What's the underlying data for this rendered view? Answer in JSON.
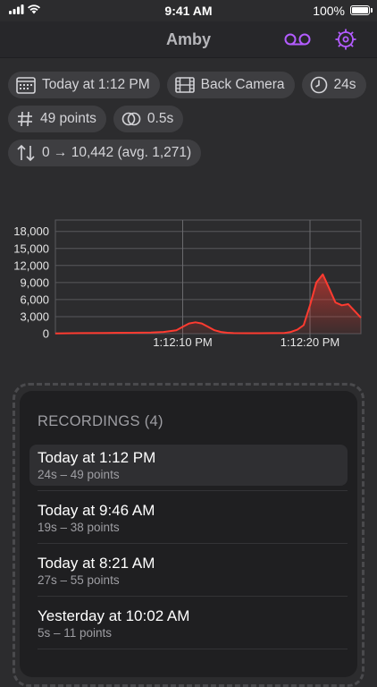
{
  "status_bar": {
    "time": "9:41 AM",
    "battery": "100%"
  },
  "nav": {
    "title": "Amby",
    "voicemail_icon": "voicemail-icon",
    "settings_icon": "gear-icon",
    "accent": "#b35cff"
  },
  "chips": {
    "date": "Today at 1:12 PM",
    "camera": "Back Camera",
    "duration": "24s",
    "points": "49 points",
    "interval": "0.5s",
    "range": "0 → 10,442 (avg. 1,271)"
  },
  "chart_data": {
    "type": "area",
    "x_tick_labels": [
      "1:12:10 PM",
      "1:12:20 PM"
    ],
    "x_range_seconds": [
      0,
      24
    ],
    "x_tick_positions_seconds": [
      10,
      20
    ],
    "y_ticks": [
      0,
      3000,
      6000,
      9000,
      12000,
      15000,
      18000
    ],
    "y_tick_labels": [
      "0",
      "3,000",
      "6,000",
      "9,000",
      "12,000",
      "15,000",
      "18,000"
    ],
    "ylim": [
      0,
      20000
    ],
    "grid": true,
    "color": "#ff3b30",
    "x": [
      0,
      2,
      4,
      6,
      7.5,
      8.5,
      9.5,
      10,
      10.5,
      11,
      11.5,
      12,
      12.5,
      13,
      13.5,
      14,
      15,
      16,
      17,
      18,
      18.5,
      19,
      19.5,
      20,
      20.5,
      21,
      21.5,
      22,
      22.5,
      23,
      23.5,
      24
    ],
    "y": [
      50,
      100,
      120,
      150,
      200,
      300,
      600,
      1200,
      1800,
      2000,
      1800,
      1200,
      600,
      300,
      150,
      100,
      80,
      80,
      90,
      120,
      300,
      700,
      1500,
      5000,
      9000,
      10442,
      8000,
      5500,
      5000,
      5200,
      4000,
      2800
    ]
  },
  "recordings": {
    "title": "RECORDINGS (4)",
    "items": [
      {
        "title": "Today at 1:12 PM",
        "subtitle": "24s – 49 points"
      },
      {
        "title": "Today at 9:46 AM",
        "subtitle": "19s – 38 points"
      },
      {
        "title": "Today at 8:21 AM",
        "subtitle": "27s – 55 points"
      },
      {
        "title": "Yesterday at 10:02 AM",
        "subtitle": "5s – 11 points"
      }
    ]
  }
}
